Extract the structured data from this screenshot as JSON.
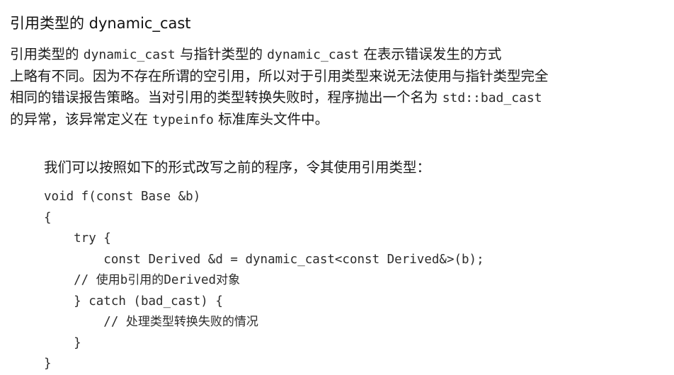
{
  "heading": "引用类型的 dynamic_cast",
  "paragraph1": {
    "line1": [
      "引用类型的 ",
      "dynamic_cast",
      " 与指针类型的 ",
      "dynamic_cast",
      " 在表示错误发生的方式"
    ],
    "line2": "上略有不同。因为不存在所谓的空引用，所以对于引用类型来说无法使用与指针类型完全",
    "line3": [
      "相同的错误报告策略。当对引用的类型转换失败时，程序抛出一个名为 ",
      "std::bad_cast"
    ],
    "line4": [
      "的异常，该异常定义在 ",
      "typeinfo",
      " 标准库头文件中。"
    ]
  },
  "paragraph2": "我们可以按照如下的形式改写之前的程序，令其使用引用类型：",
  "code": {
    "l1": "void f(const Base &b)",
    "l2": "{",
    "l3": "    try {",
    "l4": "        const Derived &d = dynamic_cast<const Derived&>(b);",
    "l5_prefix": "    // ",
    "l5_a": "使用",
    "l5_b": "b",
    "l5_c": "引用的",
    "l5_d": "Derived",
    "l5_e": "对象",
    "l6": "    } catch (bad_cast) {",
    "l7_prefix": "        // ",
    "l7_text": "处理类型转换失败的情况",
    "l8": "    }",
    "l9": "}"
  }
}
